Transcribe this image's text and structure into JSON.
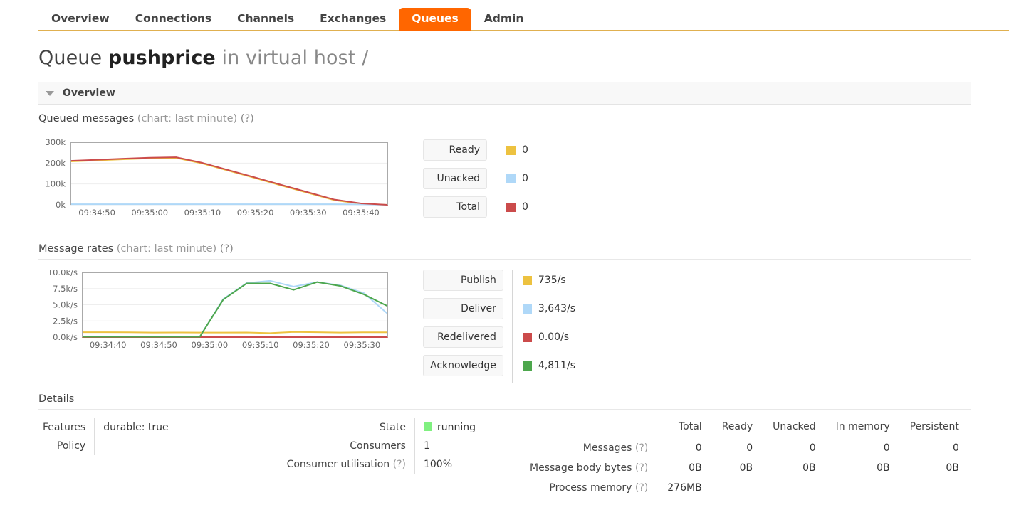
{
  "nav": {
    "items": [
      {
        "label": "Overview",
        "active": false
      },
      {
        "label": "Connections",
        "active": false
      },
      {
        "label": "Channels",
        "active": false
      },
      {
        "label": "Exchanges",
        "active": false
      },
      {
        "label": "Queues",
        "active": true
      },
      {
        "label": "Admin",
        "active": false
      }
    ]
  },
  "page": {
    "title_prefix": "Queue",
    "queue_name": "pushprice",
    "title_middle": "in virtual host",
    "vhost": "/"
  },
  "overview_section": {
    "label": "Overview",
    "caret": "caret-down-icon"
  },
  "queued_messages": {
    "title": "Queued messages",
    "subtitle": "(chart: last minute)",
    "help": "(?)",
    "legend": [
      {
        "label": "Ready",
        "value": "0",
        "color": "#edc240"
      },
      {
        "label": "Unacked",
        "value": "0",
        "color": "#afd8f8"
      },
      {
        "label": "Total",
        "value": "0",
        "color": "#cb4b4b"
      }
    ]
  },
  "message_rates": {
    "title": "Message rates",
    "subtitle": "(chart: last minute)",
    "help": "(?)",
    "legend": [
      {
        "label": "Publish",
        "value": "735/s",
        "color": "#edc240"
      },
      {
        "label": "Deliver",
        "value": "3,643/s",
        "color": "#afd8f8"
      },
      {
        "label": "Redelivered",
        "value": "0.00/s",
        "color": "#cb4b4b"
      },
      {
        "label": "Acknowledge",
        "value": "4,811/s",
        "color": "#4da74d"
      }
    ]
  },
  "chart_data": [
    {
      "type": "line",
      "title": "Queued messages",
      "subtitle": "(chart: last minute)",
      "xlabel": "",
      "ylabel": "",
      "grid": true,
      "legend_position": "right",
      "ylim": [
        0,
        300000
      ],
      "yticks": [
        0,
        100000,
        200000,
        300000
      ],
      "ytick_labels": [
        "0k",
        "100k",
        "200k",
        "300k"
      ],
      "xtick_labels": [
        "09:34:50",
        "09:35:00",
        "09:35:10",
        "09:35:20",
        "09:35:30",
        "09:35:40"
      ],
      "x": [
        "09:34:45",
        "09:34:50",
        "09:34:55",
        "09:35:00",
        "09:35:05",
        "09:35:10",
        "09:35:15",
        "09:35:20",
        "09:35:25",
        "09:35:30",
        "09:35:35",
        "09:35:40",
        "09:35:45"
      ],
      "series": [
        {
          "name": "Ready",
          "color": "#edc240",
          "values": [
            208000,
            213000,
            218000,
            223000,
            225000,
            198000,
            163000,
            128000,
            92000,
            57000,
            22000,
            5000,
            0
          ]
        },
        {
          "name": "Unacked",
          "color": "#afd8f8",
          "values": [
            3000,
            3000,
            3000,
            3000,
            3000,
            3000,
            3000,
            3000,
            3000,
            3000,
            3000,
            2000,
            0
          ]
        },
        {
          "name": "Total",
          "color": "#cb4b4b",
          "values": [
            211000,
            216000,
            221000,
            226000,
            228000,
            201000,
            166000,
            131000,
            95000,
            60000,
            25000,
            7000,
            0
          ]
        }
      ]
    },
    {
      "type": "line",
      "title": "Message rates",
      "subtitle": "(chart: last minute)",
      "xlabel": "",
      "ylabel": "",
      "grid": true,
      "legend_position": "right",
      "ylim": [
        0,
        10000
      ],
      "yticks": [
        0,
        2500,
        5000,
        7500,
        10000
      ],
      "ytick_labels": [
        "0.0k/s",
        "2.5k/s",
        "5.0k/s",
        "7.5k/s",
        "10.0k/s"
      ],
      "xtick_labels": [
        "09:34:40",
        "09:34:50",
        "09:35:00",
        "09:35:10",
        "09:35:20",
        "09:35:30"
      ],
      "x": [
        "09:34:35",
        "09:34:40",
        "09:34:45",
        "09:34:50",
        "09:34:55",
        "09:35:00",
        "09:35:05",
        "09:35:10",
        "09:35:15",
        "09:35:20",
        "09:35:25",
        "09:35:30",
        "09:35:35",
        "09:35:40"
      ],
      "series": [
        {
          "name": "Publish",
          "color": "#edc240",
          "values": [
            750,
            760,
            740,
            700,
            720,
            700,
            700,
            710,
            620,
            790,
            760,
            700,
            740,
            735
          ]
        },
        {
          "name": "Deliver",
          "color": "#afd8f8",
          "values": [
            60,
            60,
            60,
            60,
            60,
            60,
            5900,
            8350,
            8700,
            7800,
            8500,
            8000,
            6800,
            3643
          ]
        },
        {
          "name": "Redelivered",
          "color": "#cb4b4b",
          "values": [
            0,
            0,
            0,
            0,
            0,
            0,
            0,
            0,
            0,
            0,
            0,
            0,
            0,
            0
          ]
        },
        {
          "name": "Acknowledge",
          "color": "#4da74d",
          "values": [
            60,
            60,
            60,
            60,
            60,
            60,
            5800,
            8300,
            8300,
            7300,
            8500,
            7900,
            6600,
            4811
          ]
        }
      ]
    }
  ],
  "details": {
    "heading": "Details",
    "left": {
      "rows": [
        {
          "label": "Features",
          "value": "durable: true"
        },
        {
          "label": "Policy",
          "value": ""
        }
      ]
    },
    "middle": {
      "rows": [
        {
          "label": "State",
          "help": "",
          "value": "running",
          "dot": "#80f080"
        },
        {
          "label": "Consumers",
          "help": "",
          "value": "1",
          "dot": ""
        },
        {
          "label": "Consumer utilisation",
          "help": "(?)",
          "value": "100%",
          "dot": ""
        }
      ]
    },
    "messages_table": {
      "columns": [
        "Total",
        "Ready",
        "Unacked",
        "In memory",
        "Persistent"
      ],
      "rows": [
        {
          "label": "Messages",
          "help": "(?)",
          "values": [
            "0",
            "0",
            "0",
            "0",
            "0"
          ]
        },
        {
          "label": "Message body bytes",
          "help": "(?)",
          "values": [
            "0B",
            "0B",
            "0B",
            "0B",
            "0B"
          ]
        },
        {
          "label": "Process memory",
          "help": "(?)",
          "values": [
            "276MB"
          ]
        }
      ]
    }
  }
}
